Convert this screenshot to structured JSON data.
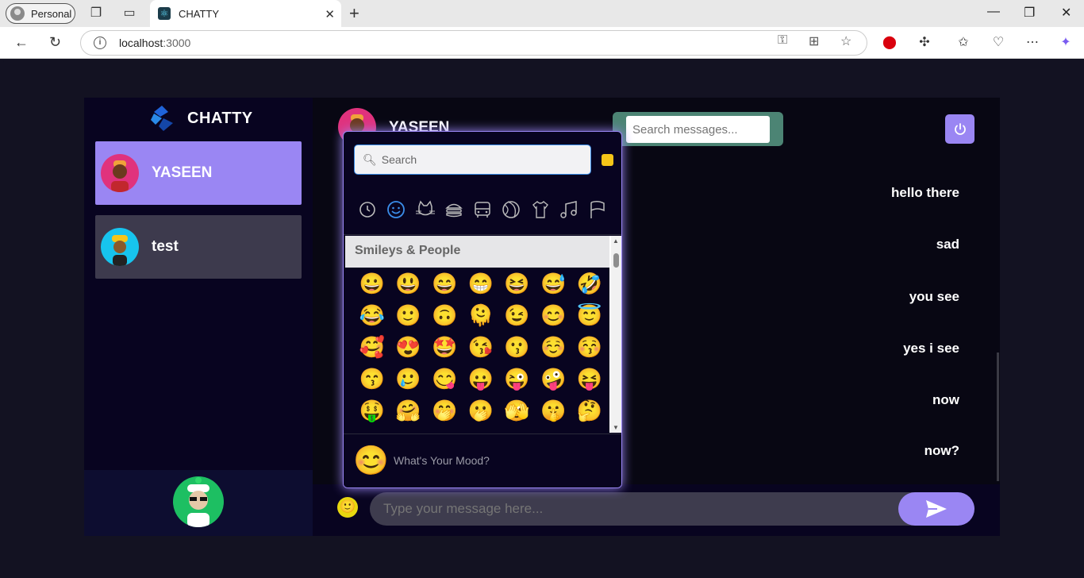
{
  "browser": {
    "profile": "Personal",
    "tab_title": "CHATTY",
    "url_host": "localhost",
    "url_port": ":3000"
  },
  "app": {
    "brand": "CHATTY",
    "contacts": [
      {
        "name": "YASEEN",
        "selected": true
      },
      {
        "name": "test",
        "selected": false
      }
    ],
    "chat": {
      "contact_name": "YASEEN",
      "search_placeholder": "Search messages...",
      "messages": [
        "hello there",
        "sad",
        "you see",
        "yes i see",
        "now",
        "now?"
      ],
      "input_placeholder": "Type your message here..."
    },
    "emoji_picker": {
      "search_placeholder": "Search",
      "categories": [
        "recent-icon",
        "smileys-icon",
        "animals-icon",
        "food-icon",
        "travel-icon",
        "activity-icon",
        "objects-icon",
        "symbols-icon",
        "flags-icon"
      ],
      "section_title": "Smileys & People",
      "emojis": [
        "😀",
        "😃",
        "😄",
        "😁",
        "😆",
        "😅",
        "🤣",
        "😂",
        "🙂",
        "🙃",
        "🫠",
        "😉",
        "😊",
        "😇",
        "🥰",
        "😍",
        "🤩",
        "😘",
        "😗",
        "☺️",
        "😚",
        "😙",
        "🥲",
        "😋",
        "😛",
        "😜",
        "🤪",
        "😝",
        "🤑",
        "🤗",
        "🤭",
        "🫢",
        "🫣",
        "🤫",
        "🤔"
      ],
      "mood_emoji": "😊",
      "mood_text": "What's Your Mood?"
    },
    "colors": {
      "accent": "#9a86f3",
      "background": "#080420",
      "search_frame": "#4c8474"
    }
  }
}
